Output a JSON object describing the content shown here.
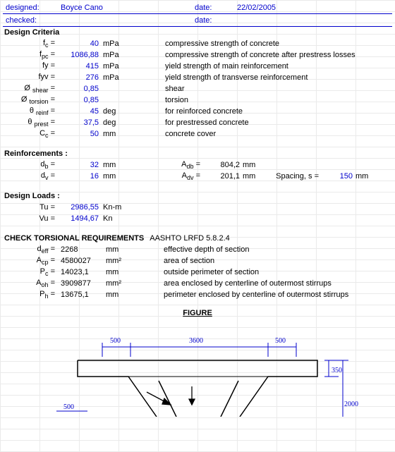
{
  "header": {
    "designed_label": "designed:",
    "designed_value": "Boyce Cano",
    "date1_label": "date:",
    "date1_value": "22/02/2005",
    "checked_label": "checked:",
    "date2_label": "date:",
    "date2_value": ""
  },
  "sections": {
    "design_criteria": "Design Criteria",
    "reinforcements": "Reinforcements :",
    "design_loads": "Design Loads :",
    "check": "CHECK TORSIONAL REQUIREMENTS",
    "check_ref": "AASHTO LRFD 5.8.2.4",
    "figure": "FIGURE"
  },
  "criteria": [
    {
      "sym": "f",
      "sub": "c",
      "eq": " =",
      "val": "40",
      "unit": "mPa",
      "desc": "compressive strength of concrete"
    },
    {
      "sym": "f",
      "sub": "pc",
      "eq": " =",
      "val": "1086,88",
      "unit": "mPa",
      "desc": "compressive strength of concrete after prestress losses"
    },
    {
      "sym": "fy",
      "sub": "",
      "eq": " =",
      "val": "415",
      "unit": "mPa",
      "desc": "yield strength of main reinforcement"
    },
    {
      "sym": "fyv",
      "sub": "",
      "eq": " =",
      "val": "276",
      "unit": "mPa",
      "desc": "yield strength of transverse reinforcement"
    },
    {
      "sym": "Ø ",
      "sub": "shear",
      "eq": " =",
      "val": "0,85",
      "unit": "",
      "desc": "shear"
    },
    {
      "sym": "Ø ",
      "sub": "torsion",
      "eq": " =",
      "val": "0,85",
      "unit": "",
      "desc": "torsion"
    },
    {
      "sym": "θ ",
      "sub": "reinf",
      "eq": " =",
      "val": "45",
      "unit": "deg",
      "desc": "for reinforced concrete"
    },
    {
      "sym": "θ ",
      "sub": "prest",
      "eq": " =",
      "val": "37,5",
      "unit": "deg",
      "desc": "for prestressed concrete"
    },
    {
      "sym": "C",
      "sub": "c",
      "eq": " =",
      "val": "50",
      "unit": "mm",
      "desc": "concrete cover"
    }
  ],
  "reinf": {
    "db_label": "d",
    "db_sub": "b",
    "db_eq": " =",
    "db_val": "32",
    "db_unit": "mm",
    "adb_label": "A",
    "adb_sub": "db",
    "adb_eq": " =",
    "adb_val": "804,2",
    "adb_unit": "mm",
    "dv_label": "d",
    "dv_sub": "v",
    "dv_eq": " =",
    "dv_val": "16",
    "dv_unit": "mm",
    "adv_label": "A",
    "adv_sub": "dv",
    "adv_eq": " =",
    "adv_val": "201,1",
    "adv_unit": "mm",
    "spacing_label": "Spacing, s =",
    "spacing_val": "150",
    "spacing_unit": "mm"
  },
  "loads": {
    "tu_label": "Tu =",
    "tu_val": "2986,55",
    "tu_unit": "Kn-m",
    "vu_label": "Vu =",
    "vu_val": "1494,67",
    "vu_unit": "Kn"
  },
  "check": [
    {
      "sym": "d",
      "sub": "eff",
      "val": "2268",
      "unit": "mm",
      "desc": "effective depth of section"
    },
    {
      "sym": "A",
      "sub": "cp",
      "val": "4580027",
      "unit": "mm²",
      "desc": "area of section"
    },
    {
      "sym": "P",
      "sub": "c",
      "val": "14023,1",
      "unit": "mm",
      "desc": "outside perimeter of section"
    },
    {
      "sym": "A",
      "sub": "oh",
      "val": "3909877",
      "unit": "mm²",
      "desc": "area enclosed by centerline of outermost stirrups"
    },
    {
      "sym": "P",
      "sub": "h",
      "val": "13675,1",
      "unit": "mm",
      "desc": "perimeter enclosed by centerline of outermost stirrups"
    }
  ],
  "figure": {
    "d500a": "500",
    "d3600": "3600",
    "d500b": "500",
    "d350": "350",
    "d2000": "2000",
    "d500c": "500"
  }
}
